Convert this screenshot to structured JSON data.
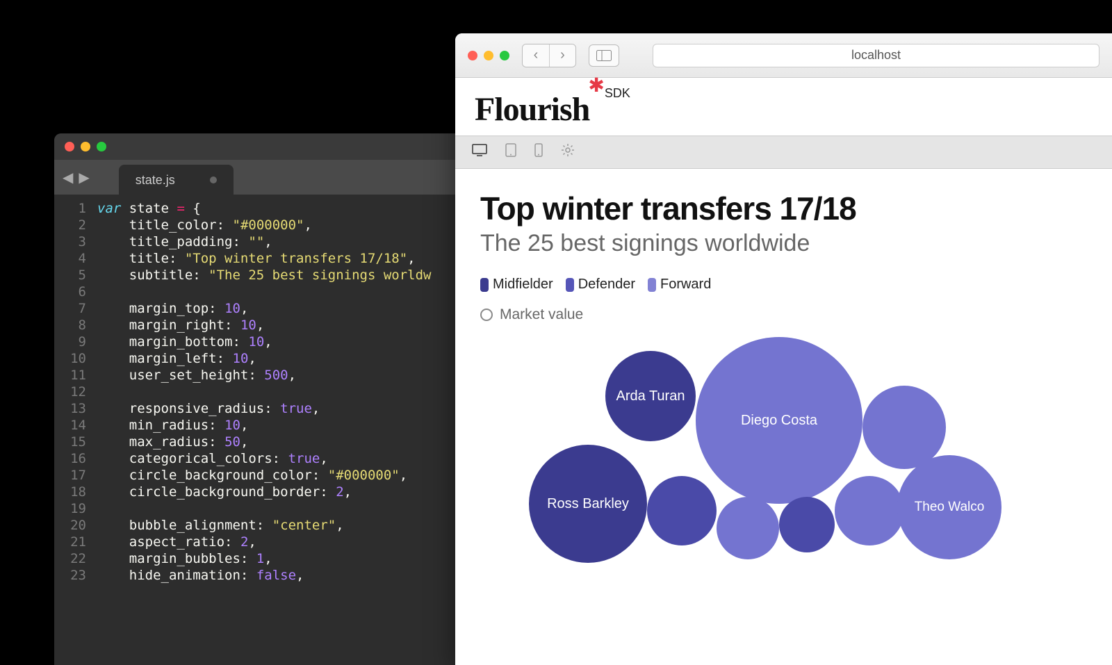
{
  "editor": {
    "tab_name": "state.js",
    "lines": [
      "1",
      "2",
      "3",
      "4",
      "5",
      "6",
      "7",
      "8",
      "9",
      "10",
      "11",
      "12",
      "13",
      "14",
      "15",
      "16",
      "17",
      "18",
      "19",
      "20",
      "21",
      "22",
      "23"
    ],
    "code": {
      "var_kw": "var",
      "var_name": "state",
      "props": {
        "title_color": "\"#000000\"",
        "title_padding": "\"\"",
        "title": "\"Top winter transfers 17/18\"",
        "subtitle": "\"The 25 best signings worldw",
        "margin_top": "10",
        "margin_right": "10",
        "margin_bottom": "10",
        "margin_left": "10",
        "user_set_height": "500",
        "responsive_radius": "true",
        "min_radius": "10",
        "max_radius": "50",
        "categorical_colors": "true",
        "circle_background_color": "\"#000000\"",
        "circle_background_border": "2",
        "bubble_alignment": "\"center\"",
        "aspect_ratio": "2",
        "margin_bubbles": "1",
        "hide_animation": "false"
      }
    }
  },
  "browser": {
    "url": "localhost",
    "logo_text": "Flourish",
    "logo_sdk": "SDK",
    "viz": {
      "title": "Top winter transfers 17/18",
      "subtitle": "The 25 best signings worldwide",
      "legend": {
        "items": [
          {
            "label": "Midfielder"
          },
          {
            "label": "Defender"
          },
          {
            "label": "Forward"
          }
        ],
        "size_label": "Market value"
      },
      "bubbles": [
        {
          "name": "Arda Turan"
        },
        {
          "name": "Diego Costa"
        },
        {
          "name": "Ross Barkley"
        },
        {
          "name": "Theo Walco"
        }
      ]
    }
  }
}
